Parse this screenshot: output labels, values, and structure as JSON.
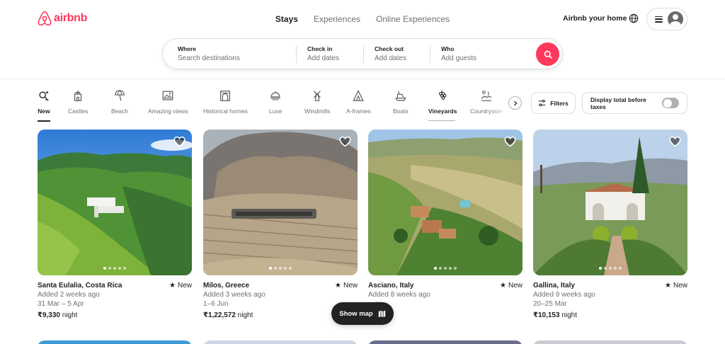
{
  "brand": {
    "name": "airbnb",
    "color": "#ff385c"
  },
  "nav": {
    "items": [
      "Stays",
      "Experiences",
      "Online Experiences"
    ],
    "active": "Stays"
  },
  "header": {
    "host_label": "Airbnb your home",
    "globe_icon": "globe-icon",
    "menu_icon": "hamburger-icon",
    "avatar_icon": "user-avatar-icon"
  },
  "search": {
    "where_label": "Where",
    "where_placeholder": "Search destinations",
    "checkin_label": "Check in",
    "checkin_value": "Add dates",
    "checkout_label": "Check out",
    "checkout_value": "Add dates",
    "who_label": "Who",
    "who_value": "Add guests",
    "button_icon": "search-icon"
  },
  "categories": {
    "items": [
      {
        "label": "New",
        "icon": "sparkle-key-icon",
        "active": true
      },
      {
        "label": "Castles",
        "icon": "castle-icon"
      },
      {
        "label": "Beach",
        "icon": "umbrella-icon"
      },
      {
        "label": "Amazing views",
        "icon": "picture-frame-icon"
      },
      {
        "label": "Historical homes",
        "icon": "historic-building-icon"
      },
      {
        "label": "Luxe",
        "icon": "luxe-bell-icon"
      },
      {
        "label": "Windmills",
        "icon": "windmill-icon"
      },
      {
        "label": "A-frames",
        "icon": "a-frame-icon"
      },
      {
        "label": "Boats",
        "icon": "boat-icon"
      },
      {
        "label": "Vineyards",
        "icon": "grapes-icon"
      },
      {
        "label": "Countryside",
        "icon": "countryside-icon"
      }
    ],
    "next_icon": "chevron-right-icon"
  },
  "filters": {
    "label": "Filters",
    "icon": "sliders-icon"
  },
  "tax_toggle": {
    "label": "Display total before taxes",
    "on": false
  },
  "listings": [
    {
      "title": "Santa Eulalia, Costa Rica",
      "badge": "New",
      "added": "Added 2 weeks ago",
      "dates": "31 Mar – 5 Apr",
      "price": "₹9,330",
      "unit": "night",
      "dots": 5,
      "active_dot": 0
    },
    {
      "title": "Milos, Greece",
      "badge": "New",
      "added": "Added 3 weeks ago",
      "dates": "1–6 Jun",
      "price": "₹1,22,572",
      "unit": "night",
      "dots": 5,
      "active_dot": 0
    },
    {
      "title": "Asciano, Italy",
      "badge": "New",
      "added": "Added 8 weeks ago",
      "dates": "…pr",
      "price": "",
      "unit": "night",
      "dots": 5,
      "active_dot": 0
    },
    {
      "title": "Gallina, Italy",
      "badge": "New",
      "added": "Added 9 weeks ago",
      "dates": "20–25 Mar",
      "price": "₹10,153",
      "unit": "night",
      "dots": 5,
      "active_dot": 0
    }
  ],
  "show_map": {
    "label": "Show map",
    "icon": "map-icon"
  }
}
